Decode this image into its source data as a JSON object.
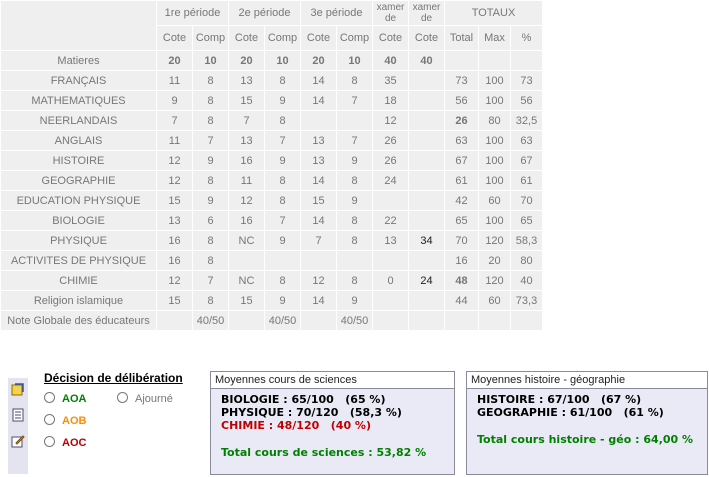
{
  "periods": [
    "1re période",
    "2e période",
    "3e période"
  ],
  "exam_label_1": "xamer\nde",
  "exam_label_2": "xamer\nde",
  "totaux_label": "TOTAUX",
  "subheaders": {
    "cote": "Cote",
    "comp": "Comp",
    "total": "Total",
    "max": "Max",
    "pct": "%"
  },
  "matieres_label": "Matieres",
  "max_row": [
    "20",
    "10",
    "20",
    "10",
    "20",
    "10",
    "40",
    "40"
  ],
  "subjects": [
    {
      "name": "FRANÇAIS",
      "v": [
        "11",
        "8",
        "13",
        "8",
        "14",
        "8",
        "35",
        "",
        "73",
        "100",
        "73"
      ]
    },
    {
      "name": "MATHEMATIQUES",
      "v": [
        "9",
        "8",
        "15",
        "9",
        "14",
        "7",
        "18",
        "",
        "56",
        "100",
        "56"
      ]
    },
    {
      "name": "NEERLANDAIS",
      "v": [
        "7",
        "8",
        "7",
        "8",
        "",
        "",
        "12",
        "",
        "26",
        "80",
        "32,5"
      ]
    },
    {
      "name": "ANGLAIS",
      "v": [
        "11",
        "7",
        "13",
        "7",
        "13",
        "7",
        "26",
        "",
        "63",
        "100",
        "63"
      ]
    },
    {
      "name": "HISTOIRE",
      "v": [
        "12",
        "9",
        "16",
        "9",
        "13",
        "9",
        "26",
        "",
        "67",
        "100",
        "67"
      ]
    },
    {
      "name": "GEOGRAPHIE",
      "v": [
        "12",
        "8",
        "11",
        "8",
        "14",
        "8",
        "24",
        "",
        "61",
        "100",
        "61"
      ]
    },
    {
      "name": "EDUCATION PHYSIQUE",
      "v": [
        "15",
        "9",
        "12",
        "8",
        "15",
        "9",
        "",
        "",
        "42",
        "60",
        "70"
      ]
    },
    {
      "name": "BIOLOGIE",
      "v": [
        "13",
        "6",
        "16",
        "7",
        "14",
        "8",
        "22",
        "",
        "65",
        "100",
        "65"
      ]
    },
    {
      "name": "PHYSIQUE",
      "v": [
        "16",
        "8",
        "NC",
        "9",
        "7",
        "8",
        "13",
        "34",
        "70",
        "120",
        "58,3"
      ]
    },
    {
      "name": "ACTIVITES DE PHYSIQUE",
      "v": [
        "16",
        "8",
        "",
        "",
        "",
        "",
        "",
        "",
        "16",
        "20",
        "80"
      ]
    },
    {
      "name": "CHIMIE",
      "v": [
        "12",
        "7",
        "NC",
        "8",
        "12",
        "8",
        "0",
        "24",
        "48",
        "120",
        "40"
      ]
    },
    {
      "name": "Religion islamique",
      "v": [
        "15",
        "8",
        "15",
        "9",
        "14",
        "9",
        "",
        "",
        "44",
        "60",
        "73,3"
      ]
    }
  ],
  "note_globale": {
    "label": "Note Globale des éducateurs",
    "values": [
      "40/50",
      "40/50",
      "40/50"
    ]
  },
  "decision": {
    "title": "Décision de délibération",
    "options": [
      {
        "label": "AOA",
        "color": "#008000"
      },
      {
        "label": "AOB",
        "color": "#ff8c00"
      },
      {
        "label": "AOC",
        "color": "#c00000"
      },
      {
        "label": "Ajourné",
        "color": "#777777"
      }
    ]
  },
  "sciences": {
    "title": "Moyennes cours de sciences",
    "lines": [
      {
        "text": "BIOLOGIE : 65/100   (65 %)",
        "color": "#000000"
      },
      {
        "text": "PHYSIQUE : 70/120   (58,3 %)",
        "color": "#000000"
      },
      {
        "text": "CHIMIE : 48/120   (40 %)",
        "color": "#c00000"
      }
    ],
    "total": "Total cours de sciences : 53,82 %"
  },
  "histgeo": {
    "title": "Moyennes histoire - géographie",
    "lines": [
      {
        "text": "HISTOIRE : 67/100   (67 %)",
        "color": "#000000"
      },
      {
        "text": "GEOGRAPHIE : 61/100   (61 %)",
        "color": "#000000"
      }
    ],
    "total": "Total cours histoire - géo : 64,00 %"
  },
  "colors": {
    "header": "#d2d2f8",
    "subject_bg": "#9b9bf4",
    "cell_bg": "#efefef",
    "max_text": "#000080",
    "total_text": "#008000",
    "alert": "#9b0000"
  },
  "icons": [
    "notes-icon",
    "document-icon",
    "edit-icon"
  ]
}
